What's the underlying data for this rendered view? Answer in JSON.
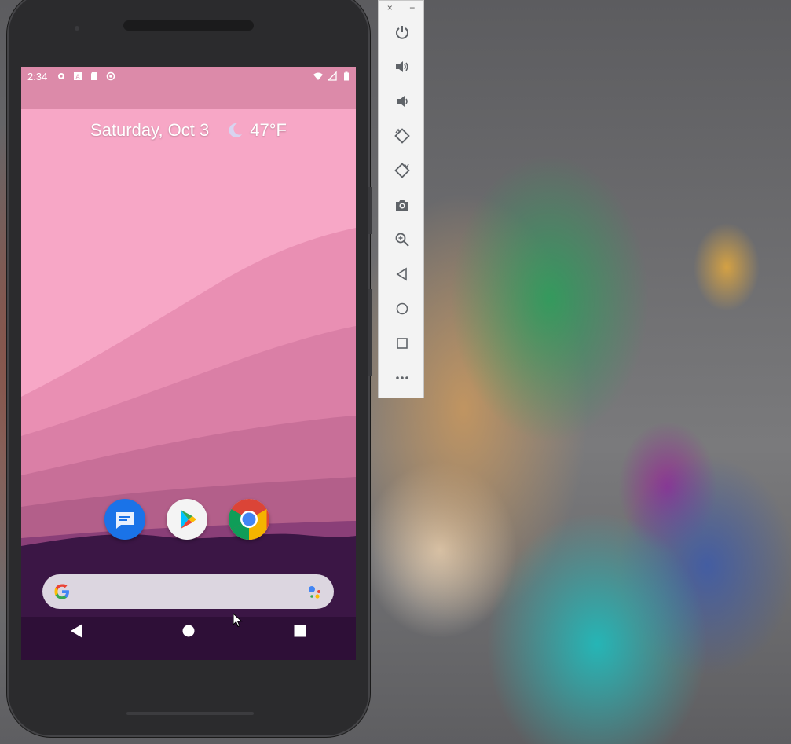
{
  "status_bar": {
    "time": "2:34"
  },
  "home_screen": {
    "date": "Saturday, Oct 3",
    "temperature": "47°F",
    "weather_icon": "moon-icon",
    "dock_apps": [
      {
        "name": "Messages",
        "icon": "messages-icon"
      },
      {
        "name": "Play Store",
        "icon": "play-store-icon"
      },
      {
        "name": "Chrome",
        "icon": "chrome-icon"
      }
    ],
    "search_bar": {
      "left_icon": "google-g-icon",
      "right_icon": "assistant-icon"
    }
  },
  "nav_bar": {
    "buttons": [
      "back-icon",
      "home-icon",
      "recents-icon"
    ]
  },
  "emulator_toolbar": {
    "close_label": "×",
    "minimize_label": "−",
    "buttons": [
      "power",
      "volume-up",
      "volume-down",
      "rotate-left",
      "rotate-right",
      "screenshot",
      "zoom",
      "back",
      "home",
      "overview",
      "more"
    ]
  },
  "colors": {
    "wallpaper_pink": "#f7a7c6",
    "wallpaper_purple": "#3b1645",
    "search_bar": "#dcd6e0",
    "phone_body": "#2b2b2d"
  }
}
